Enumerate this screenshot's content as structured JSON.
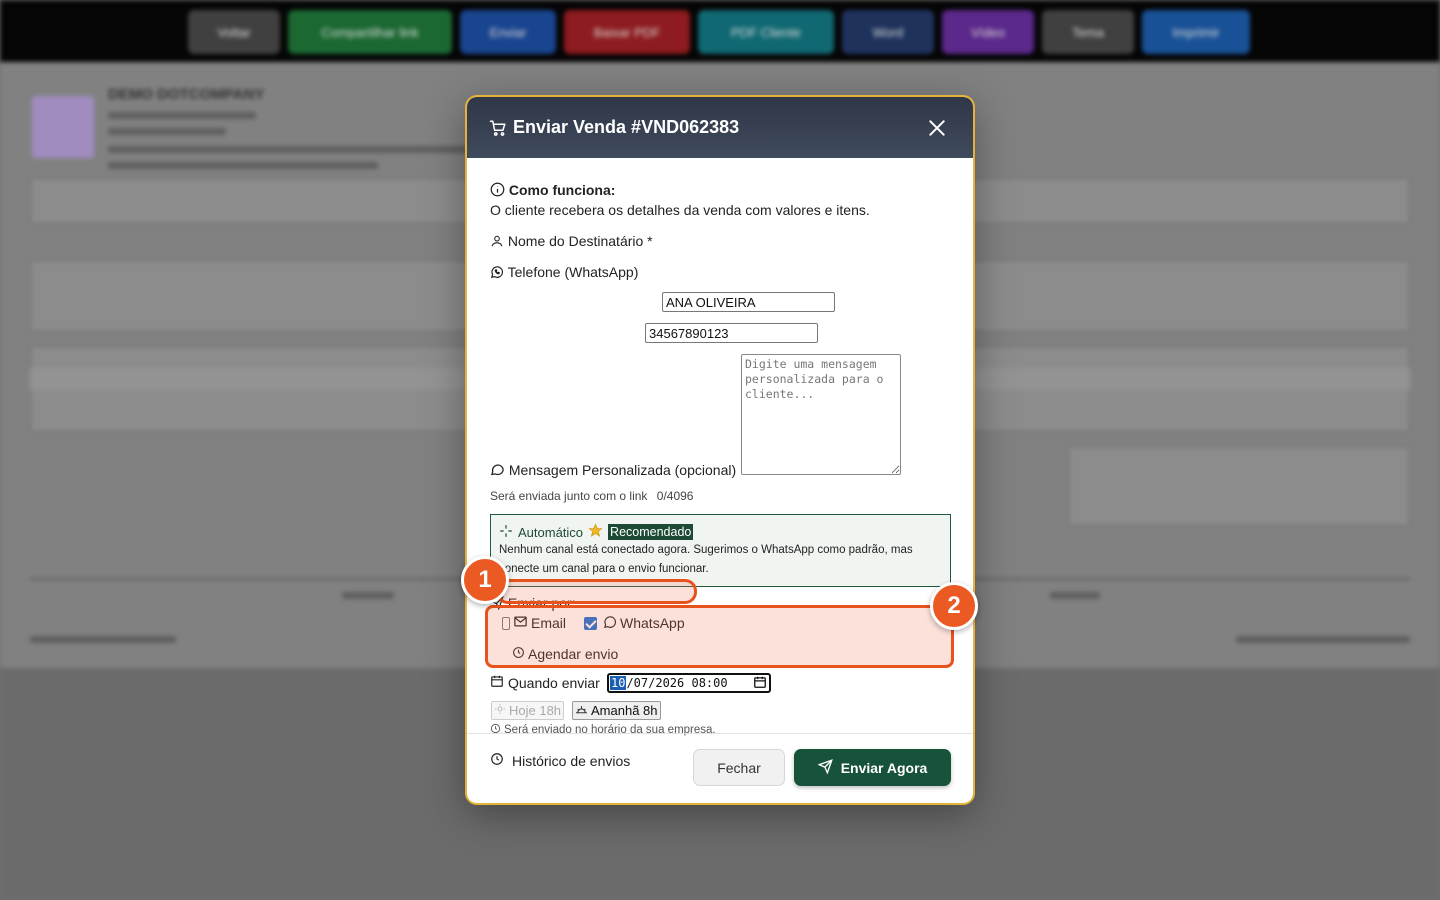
{
  "background": {
    "toolbar": [
      {
        "label": "Voltar",
        "color": "#4b4b4b"
      },
      {
        "label": "Compartilhar link",
        "color": "#1f7a3a"
      },
      {
        "label": "Enviar",
        "color": "#1d4fa8"
      },
      {
        "label": "Baixar PDF",
        "color": "#a51f24"
      },
      {
        "label": "PDF Cliente",
        "color": "#137a86"
      },
      {
        "label": "Word",
        "color": "#233a6b"
      },
      {
        "label": "Vídeo",
        "color": "#6b2fa3"
      },
      {
        "label": "Tema",
        "color": "#4b4b4b"
      },
      {
        "label": "Imprimir",
        "color": "#1d5fb0"
      }
    ],
    "company_name": "DEMO DOTCOMPANY"
  },
  "modal": {
    "title": "Enviar Venda #VND062383",
    "info_title": "Como funciona:",
    "info_text": "O cliente recebera os detalhes da venda com valores e itens.",
    "recipient_label": "Nome do Destinatário *",
    "recipient_value": "ANA OLIVEIRA",
    "phone_label": "Telefone (WhatsApp)",
    "phone_value": "34567890123",
    "message_label": "Mensagem Personalizada (opcional)",
    "message_placeholder": "Digite uma mensagem personalizada para o cliente...",
    "message_hint": "Será enviada junto com o link",
    "message_counter": "0/4096",
    "auto_title": "Automático",
    "auto_badge": "Recomendado",
    "auto_text": "Nenhum canal está conectado agora. Sugerimos o WhatsApp como padrão, mas conecte um canal para o envio funcionar.",
    "send_via_label": "Enviar por:",
    "channel_email": "Email",
    "channel_whatsapp": "WhatsApp",
    "schedule_label": "Agendar envio",
    "when_label": "Quando enviar",
    "datetime_day": "10",
    "datetime_rest": "/07/2026 08:00",
    "quick_today": "Hoje 18h",
    "quick_tomorrow": "Amanhã 8h",
    "timezone_hint": "Será enviado no horário da sua empresa.",
    "history_label": "Histórico de envios",
    "close_button": "Fechar",
    "send_button": "Enviar Agora"
  },
  "annotations": {
    "marker_1": "1",
    "marker_2": "2",
    "accent_color": "#ea5a22"
  }
}
